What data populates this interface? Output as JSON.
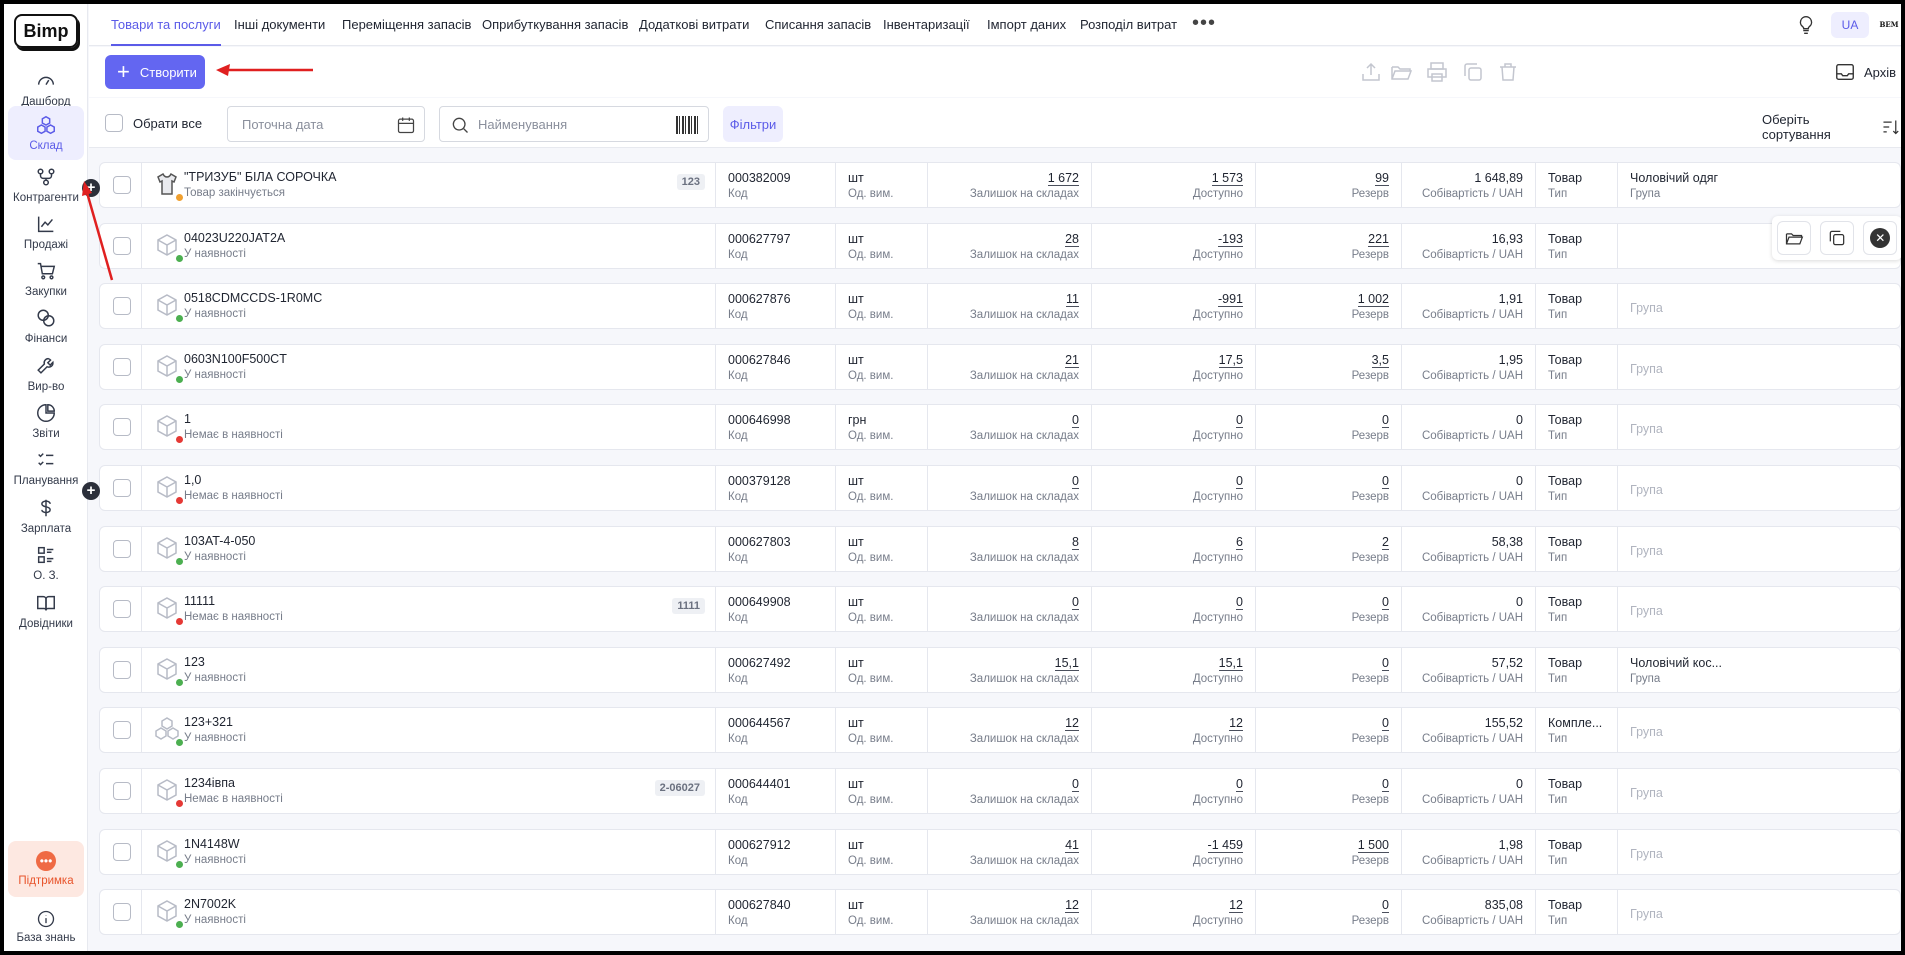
{
  "app": {
    "logo": "Bimp"
  },
  "sidebar": {
    "items": [
      {
        "label": "Дашборд",
        "icon": "gauge-icon"
      },
      {
        "label": "Склад",
        "icon": "boxes-icon",
        "active": true
      },
      {
        "label": "Контрагенти",
        "icon": "network-icon"
      },
      {
        "label": "Продажі",
        "icon": "chart-line-icon"
      },
      {
        "label": "Закупки",
        "icon": "cart-icon"
      },
      {
        "label": "Фінанси",
        "icon": "coins-icon"
      },
      {
        "label": "Вир-во",
        "icon": "wrench-icon"
      },
      {
        "label": "Звіти",
        "icon": "pie-chart-icon"
      },
      {
        "label": "Планування",
        "icon": "checklist-icon"
      },
      {
        "label": "Зарплата",
        "icon": "dollar-icon"
      },
      {
        "label": "О. З.",
        "icon": "grid-list-icon"
      },
      {
        "label": "Довідники",
        "icon": "book-icon"
      }
    ],
    "support_label": "Підтримка",
    "kb_label": "База знань"
  },
  "tabs": [
    {
      "label": "Товари та послуги",
      "active": true
    },
    {
      "label": "Інші документи"
    },
    {
      "label": "Переміщення запасів"
    },
    {
      "label": "Оприбуткування запасів"
    },
    {
      "label": "Додаткові витрати"
    },
    {
      "label": "Списання запасів"
    },
    {
      "label": "Інвентаризації"
    },
    {
      "label": "Імпорт даних"
    },
    {
      "label": "Розподіл витрат"
    }
  ],
  "header": {
    "more": "•••",
    "lang": "UA",
    "avatar": "BEM"
  },
  "toolbar": {
    "create_label": "Створити",
    "archive_label": "Архів"
  },
  "filters": {
    "select_all": "Обрати все",
    "date_placeholder": "Поточна дата",
    "search_placeholder": "Найменування",
    "filters_label": "Фільтри",
    "sort_label": "Оберіть сортування"
  },
  "labels": {
    "code": "Код",
    "unit": "Од. вим.",
    "stock": "Залишок на складах",
    "avail": "Доступно",
    "reserve": "Резерв",
    "cost": "Собівартість / UAH",
    "type": "Тип",
    "group": "Група"
  },
  "colors": {
    "accent": "#6366f1",
    "in_stock": "#4caf50",
    "out_stock": "#e53935",
    "low_stock": "#f0a030"
  },
  "rows": [
    {
      "name": "\"ТРИЗУБ\" БІЛА СОРОЧКА",
      "status": "Товар закінчується",
      "status_color": "orange",
      "badge": "123",
      "code": "000382009",
      "unit": "шт",
      "stock": "1 672",
      "avail": "1 573",
      "reserve": "99",
      "cost": "1 648,89",
      "type": "Товар",
      "group": "Чоловічий одяг",
      "group_label": "Група",
      "plus": true,
      "icon": "shirt"
    },
    {
      "name": "04023U220JAT2A",
      "status": "У наявності",
      "status_color": "green",
      "badge": "",
      "code": "000627797",
      "unit": "шт",
      "stock": "28",
      "avail": "-193",
      "reserve": "221",
      "cost": "16,93",
      "type": "Товар",
      "group": "",
      "group_label": "",
      "plus": false,
      "icon": "box"
    },
    {
      "name": "0518CDMCCDS-1R0MC",
      "status": "У наявності",
      "status_color": "green",
      "badge": "",
      "code": "000627876",
      "unit": "шт",
      "stock": "11",
      "avail": "-991",
      "reserve": "1 002",
      "cost": "1,91",
      "type": "Товар",
      "group": "",
      "group_label": "Група",
      "plus": false,
      "icon": "box"
    },
    {
      "name": "0603N100F500CT",
      "status": "У наявності",
      "status_color": "green",
      "badge": "",
      "code": "000627846",
      "unit": "шт",
      "stock": "21",
      "avail": "17,5",
      "reserve": "3,5",
      "cost": "1,95",
      "type": "Товар",
      "group": "",
      "group_label": "Група",
      "plus": false,
      "icon": "box"
    },
    {
      "name": "1",
      "status": "Немає в наявності",
      "status_color": "red",
      "badge": "",
      "code": "000646998",
      "unit": "грн",
      "stock": "0",
      "avail": "0",
      "reserve": "0",
      "cost": "0",
      "type": "Товар",
      "group": "",
      "group_label": "Група",
      "plus": false,
      "icon": "box"
    },
    {
      "name": "1,0",
      "status": "Немає в наявності",
      "status_color": "red",
      "badge": "",
      "code": "000379128",
      "unit": "шт",
      "stock": "0",
      "avail": "0",
      "reserve": "0",
      "cost": "0",
      "type": "Товар",
      "group": "",
      "group_label": "Група",
      "plus": true,
      "icon": "box"
    },
    {
      "name": "103AT-4-050",
      "status": "У наявності",
      "status_color": "green",
      "badge": "",
      "code": "000627803",
      "unit": "шт",
      "stock": "8",
      "avail": "6",
      "reserve": "2",
      "cost": "58,38",
      "type": "Товар",
      "group": "",
      "group_label": "Група",
      "plus": false,
      "icon": "box"
    },
    {
      "name": "11111",
      "status": "Немає в наявності",
      "status_color": "red",
      "badge": "1111",
      "code": "000649908",
      "unit": "шт",
      "stock": "0",
      "avail": "0",
      "reserve": "0",
      "cost": "0",
      "type": "Товар",
      "group": "",
      "group_label": "Група",
      "plus": false,
      "icon": "box"
    },
    {
      "name": "123",
      "status": "У наявності",
      "status_color": "green",
      "badge": "",
      "code": "000627492",
      "unit": "шт",
      "stock": "15,1",
      "avail": "15,1",
      "reserve": "0",
      "cost": "57,52",
      "type": "Товар",
      "group": "Чоловічий кос...",
      "group_label": "Група",
      "plus": false,
      "icon": "box"
    },
    {
      "name": "123+321",
      "status": "У наявності",
      "status_color": "green",
      "badge": "",
      "code": "000644567",
      "unit": "шт",
      "stock": "12",
      "avail": "12",
      "reserve": "0",
      "cost": "155,52",
      "type": "Компле...",
      "group": "",
      "group_label": "Група",
      "plus": false,
      "icon": "boxes"
    },
    {
      "name": "1234івпа",
      "status": "Немає в наявності",
      "status_color": "red",
      "badge": "2-06027",
      "code": "000644401",
      "unit": "шт",
      "stock": "0",
      "avail": "0",
      "reserve": "0",
      "cost": "0",
      "type": "Товар",
      "group": "",
      "group_label": "Група",
      "plus": false,
      "icon": "box"
    },
    {
      "name": "1N4148W",
      "status": "У наявності",
      "status_color": "green",
      "badge": "",
      "code": "000627912",
      "unit": "шт",
      "stock": "41",
      "avail": "-1 459",
      "reserve": "1 500",
      "cost": "1,98",
      "type": "Товар",
      "group": "",
      "group_label": "Група",
      "plus": false,
      "icon": "box"
    },
    {
      "name": "2N7002K",
      "status": "У наявності",
      "status_color": "green",
      "badge": "",
      "code": "000627840",
      "unit": "шт",
      "stock": "12",
      "avail": "12",
      "reserve": "0",
      "cost": "835,08",
      "type": "Товар",
      "group": "",
      "group_label": "Група",
      "plus": false,
      "icon": "box"
    }
  ]
}
